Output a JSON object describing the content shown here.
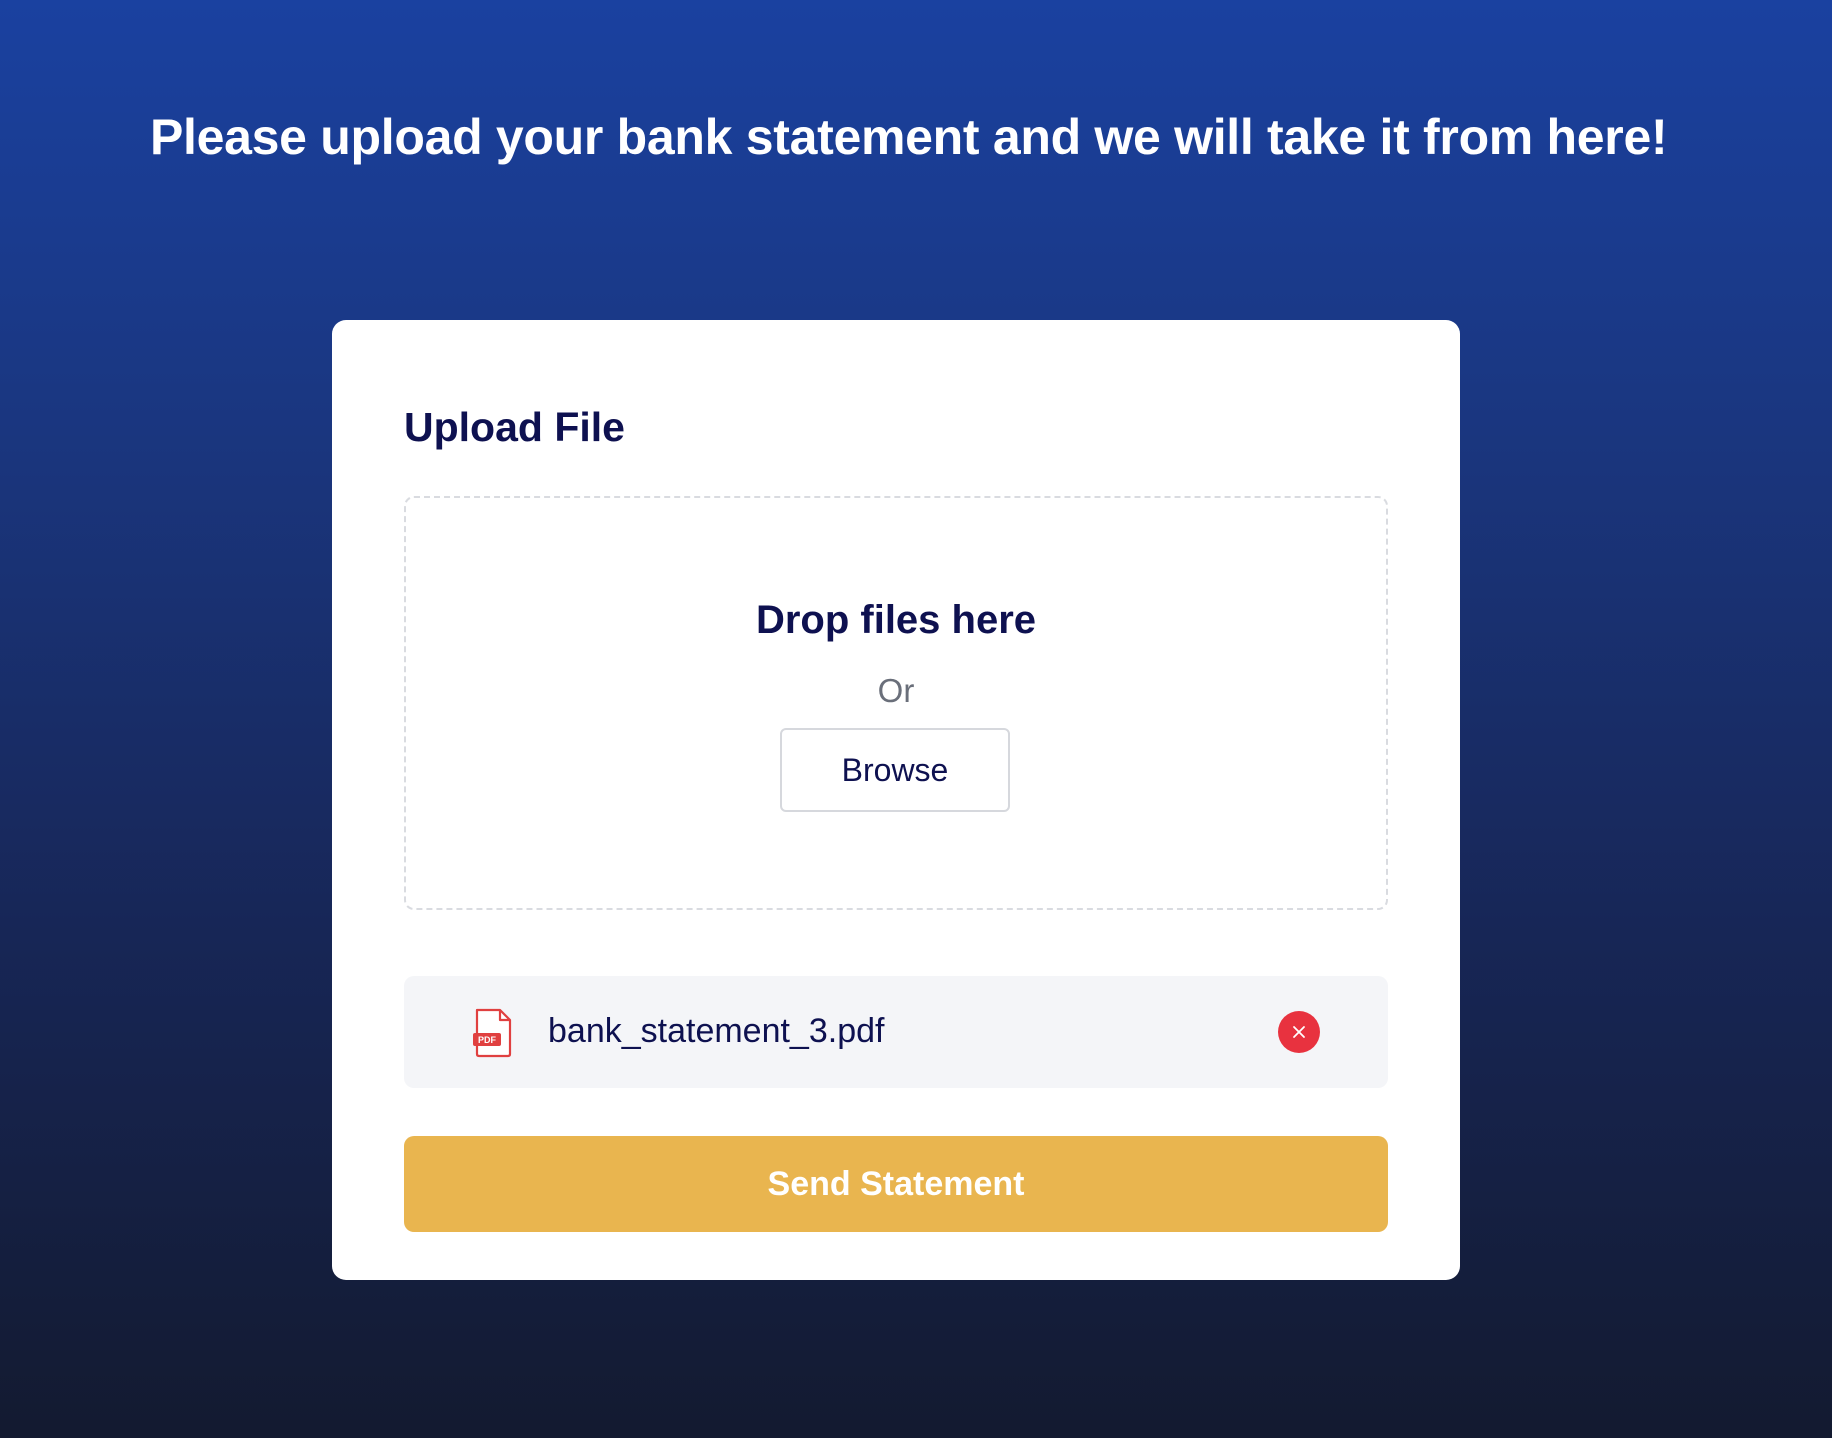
{
  "page": {
    "heading": "Please upload your bank statement and we will take it from here!"
  },
  "upload_card": {
    "title": "Upload File",
    "dropzone": {
      "title": "Drop files here",
      "or_text": "Or",
      "browse_label": "Browse"
    },
    "file": {
      "name": "bank_statement_3.pdf",
      "type_badge": "PDF",
      "icon": "pdf-file-icon",
      "remove_icon": "close-icon"
    },
    "submit_label": "Send Statement"
  },
  "colors": {
    "background_top": "#1a41a0",
    "background_bottom": "#131a30",
    "text_dark": "#0e1150",
    "accent_button": "#e9b54f",
    "remove_button": "#e8323f",
    "pdf_icon": "#e04040"
  }
}
